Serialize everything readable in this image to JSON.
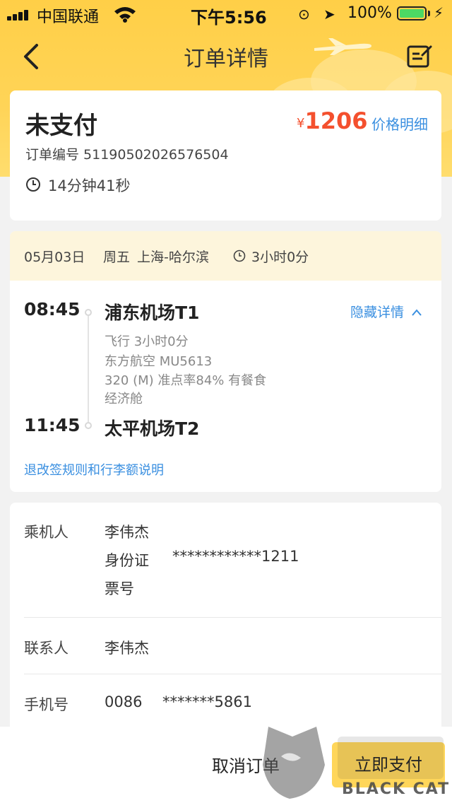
{
  "status_bar": {
    "carrier": "中国联通",
    "time": "下午5:56",
    "battery_pct": "100%",
    "battery_level": 1.0
  },
  "nav": {
    "back_icon": "chevron-left-icon",
    "title": "订单详情",
    "edit_icon": "edit-note-icon"
  },
  "order": {
    "status": "未支付",
    "currency": "¥",
    "price": "1206",
    "price_detail_link": "价格明细",
    "order_number": "订单编号 51190502026576504",
    "countdown": "14分钟41秒"
  },
  "flight": {
    "date": "05月03日",
    "weekday": "周五",
    "route": "上海-哈尔滨",
    "duration_summary": "3小时0分",
    "departure_time": "08:45",
    "departure_airport": "浦东机场T1",
    "arrival_time": "11:45",
    "arrival_airport": "太平机场T2",
    "hide_details": "隐藏详情",
    "info_lines": [
      "飞行 3小时0分",
      "东方航空 MU5613",
      "320 (M)  准点率84% 有餐食",
      "经济舱"
    ],
    "rules_link": "退改签规则和行李额说明"
  },
  "passenger": {
    "passenger_label": "乘机人",
    "passenger_name": "李伟杰",
    "id_type": "身份证",
    "id_number": "************1211",
    "ticket_label": "票号",
    "contact_label": "联系人",
    "contact_name": "李伟杰",
    "phone_label": "手机号",
    "phone_prefix": "0086",
    "phone_number": "*******5861"
  },
  "actions": {
    "cancel": "取消订单",
    "pay": "立即支付"
  },
  "watermark": {
    "brand_cn": "黑猫",
    "brand_en": "BLACK CAT"
  },
  "colors": {
    "header_yellow": "#ffd457",
    "price_red": "#f4502e",
    "link_blue": "#3a8fe0",
    "route_bar": "#fdf5dc",
    "pay_button": "#ffd65a"
  }
}
